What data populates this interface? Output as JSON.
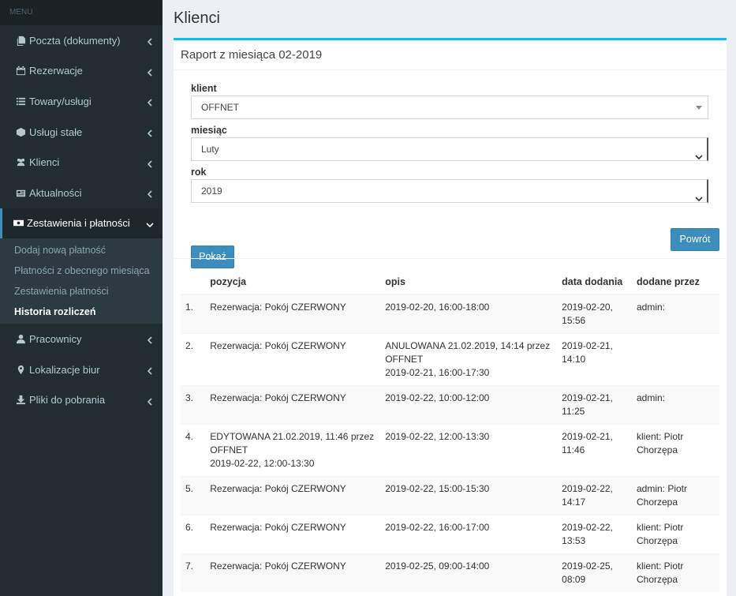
{
  "sidebar": {
    "header": "MENU",
    "items": [
      {
        "label": "Poczta (dokumenty)",
        "icon": "copy-icon"
      },
      {
        "label": "Rezerwacje",
        "icon": "calendar-icon"
      },
      {
        "label": "Towary/usługi",
        "icon": "list-icon"
      },
      {
        "label": "Usługi stałe",
        "icon": "cube-icon"
      },
      {
        "label": "Klienci",
        "icon": "users-icon"
      },
      {
        "label": "Aktualności",
        "icon": "newspaper-icon"
      },
      {
        "label": "Zestawienia i płatności",
        "icon": "money-icon",
        "active": true
      },
      {
        "label": "Pracownicy",
        "icon": "user-icon"
      },
      {
        "label": "Lokalizacje biur",
        "icon": "map-marker-icon"
      },
      {
        "label": "Pliki do pobrania",
        "icon": "download-icon"
      }
    ],
    "submenu": [
      {
        "label": "Dodaj nową płatność"
      },
      {
        "label": "Płatności z obecnego miesiąca"
      },
      {
        "label": "Zestawienia płatności"
      },
      {
        "label": "Historia rozliczeń",
        "active": true
      }
    ]
  },
  "page": {
    "title": "Klienci",
    "box_title": "Raport z miesiąca 02-2019"
  },
  "form": {
    "client_label": "klient",
    "client_value": "OFFNET",
    "month_label": "miesiąc",
    "month_value": "Luty",
    "year_label": "rok",
    "year_value": "2019",
    "show_button": "Pokaż",
    "back_button": "Powrót"
  },
  "table": {
    "headers": [
      "",
      "pozycja",
      "opis",
      "data dodania",
      "dodane przez"
    ],
    "rows": [
      {
        "num": "1.",
        "pozycja": [
          "Rezerwacja: Pokój CZERWONY"
        ],
        "opis": [
          "2019-02-20, 16:00-18:00"
        ],
        "data": [
          "2019-02-20,",
          "15:56"
        ],
        "by": [
          "admin:"
        ]
      },
      {
        "num": "2.",
        "pozycja": [
          "Rezerwacja: Pokój CZERWONY"
        ],
        "opis": [
          "ANULOWANA 21.02.2019, 14:14 przez",
          "OFFNET",
          "2019-02-21, 16:00-17:30"
        ],
        "data": [
          "2019-02-21,",
          "14:10"
        ],
        "by": [
          ""
        ]
      },
      {
        "num": "3.",
        "pozycja": [
          "Rezerwacja: Pokój CZERWONY"
        ],
        "opis": [
          "2019-02-22, 10:00-12:00"
        ],
        "data": [
          "2019-02-21,",
          "11:25"
        ],
        "by": [
          "admin:"
        ]
      },
      {
        "num": "4.",
        "pozycja": [
          "EDYTOWANA 21.02.2019, 11:46 przez",
          "OFFNET",
          "2019-02-22, 12:00-13:30"
        ],
        "opis": [
          "2019-02-22, 12:00-13:30"
        ],
        "data": [
          "2019-02-21,",
          "11:46"
        ],
        "by": [
          "klient: Piotr",
          "Chorzępa"
        ]
      },
      {
        "num": "5.",
        "pozycja": [
          "Rezerwacja: Pokój CZERWONY"
        ],
        "opis": [
          "2019-02-22, 15:00-15:30"
        ],
        "data": [
          "2019-02-22,",
          "14:17"
        ],
        "by": [
          "admin: Piotr",
          "Chorzepa"
        ]
      },
      {
        "num": "6.",
        "pozycja": [
          "Rezerwacja: Pokój CZERWONY"
        ],
        "opis": [
          "2019-02-22, 16:00-17:00"
        ],
        "data": [
          "2019-02-22,",
          "13:53"
        ],
        "by": [
          "klient: Piotr",
          "Chorzępa"
        ]
      },
      {
        "num": "7.",
        "pozycja": [
          "Rezerwacja: Pokój CZERWONY"
        ],
        "opis": [
          "2019-02-25, 09:00-14:00"
        ],
        "data": [
          "2019-02-25,",
          "08:09"
        ],
        "by": [
          "klient: Piotr",
          "Chorzępa"
        ]
      }
    ]
  },
  "colors": {
    "sidebar_bg": "#222d32",
    "accent": "#3c8dbc",
    "box_top": "#00c0ef"
  }
}
